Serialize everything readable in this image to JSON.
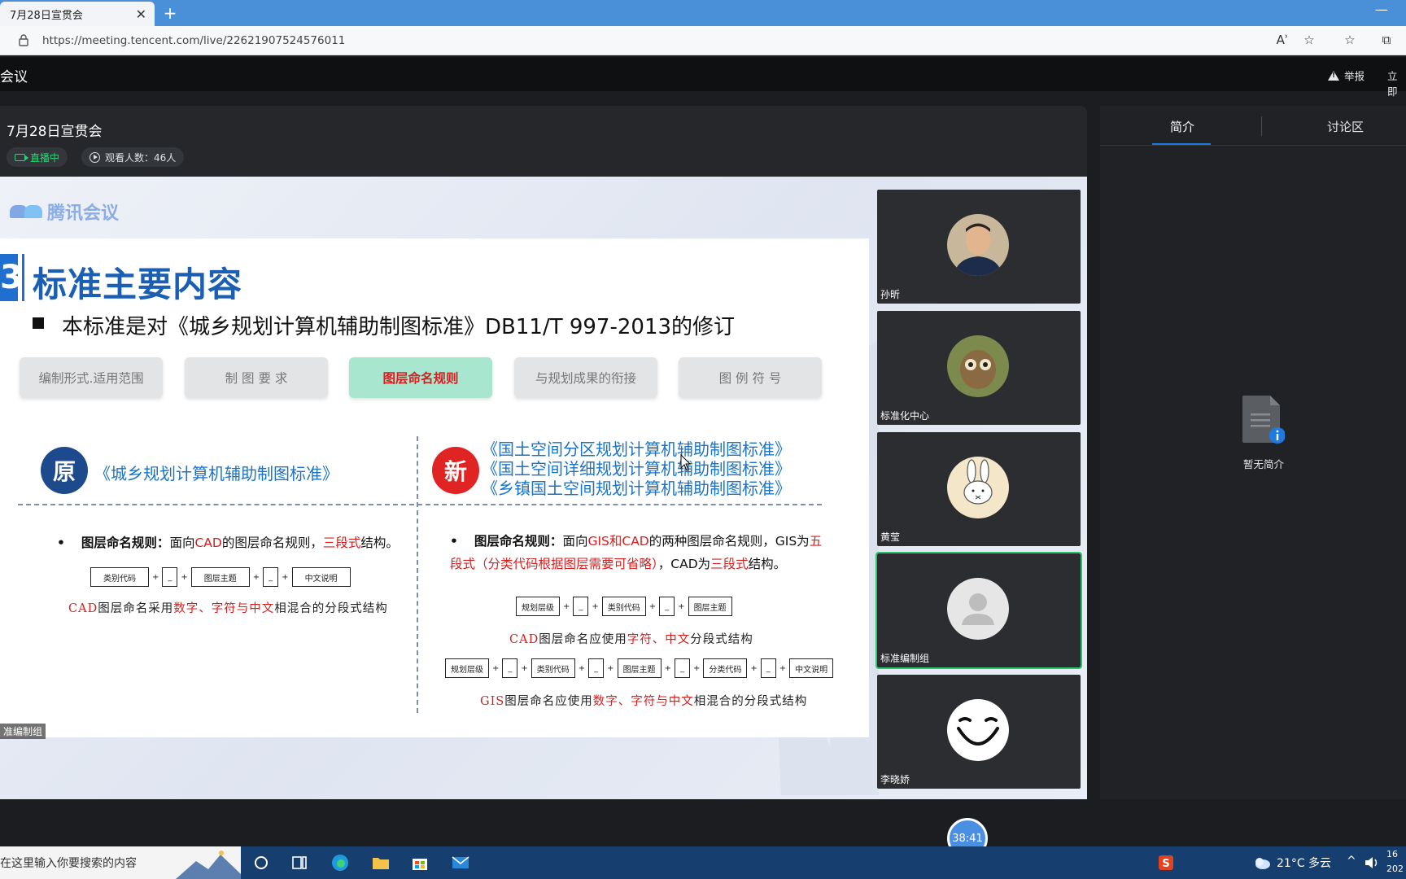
{
  "browser": {
    "tab_title": "7月28日宣贯会",
    "tab_close": "✕",
    "new_tab": "+",
    "minimize": "—",
    "url": "https://meeting.tencent.com/live/22621907524576011",
    "read_aloud": "Aʾ",
    "favorites_add": "☆",
    "favorites": "☆",
    "collections": "⧉"
  },
  "app": {
    "name": "会议",
    "report_label": "举报",
    "join_label": "立即"
  },
  "live": {
    "title": "7月28日宣贯会",
    "status": "直播中",
    "viewers": "观看人数：46人"
  },
  "slide": {
    "brand": "腾讯会议",
    "section_number": "3",
    "section_title": "标准主要内容",
    "subtitle": "本标准是对《城乡规划计算机辅助制图标准》DB11/T 997-2013的修订",
    "pills": [
      "编制形式.适用范围",
      "制 图 要 求",
      "图层命名规则",
      "与规划成果的衔接",
      "图 例 符 号"
    ],
    "old_mark": "原",
    "old_name": "《城乡规划计算机辅助制图标准》",
    "new_mark": "新",
    "new_names": [
      "《国土空间分区规划计算机辅助制图标准》",
      "《国土空间详细规划计算机辅助制图标准》",
      "《乡镇国土空间规划计算机辅助制图标准》"
    ],
    "left_rule": {
      "bullet": "•",
      "label": "图层命名规则：",
      "t1": "面向",
      "cad": "CAD",
      "t2": "的图层命名规则，",
      "three": "三段式",
      "t3": "结构。",
      "boxes": [
        "类别代码",
        "_",
        "图层主题",
        "_",
        "中文说明"
      ],
      "note_a": "CAD",
      "note_b": "图层命名采用",
      "note_c": "数字、字符与中文",
      "note_d": "相混合的分段式结构"
    },
    "right_rule": {
      "bullet": "•",
      "label": "图层命名规则：",
      "t1": "面向",
      "gis_cad": "GIS和CAD",
      "t2": "的两种图层命名规则，GIS为",
      "five": "五段式（分类代码根据图层需要可省略）",
      "t3": "，CAD为",
      "three": "三段式",
      "t4": "结构。",
      "cad_boxes": [
        "规划层级",
        "_",
        "类别代码",
        "_",
        "图层主题"
      ],
      "cad_note_a": "CAD",
      "cad_note_b": "图层命名应使用",
      "cad_note_c": "字符、中文",
      "cad_note_d": "分段式结构",
      "gis_boxes": [
        "规划层级",
        "_",
        "类别代码",
        "_",
        "图层主题",
        "_",
        "分类代码",
        "_",
        "中文说明"
      ],
      "gis_note_a": "GIS",
      "gis_note_b": "图层命名应使用",
      "gis_note_c": "数字、字符与中文",
      "gis_note_d": "相混合的分段式结构"
    },
    "box_sep": "+",
    "corner_label": "准编制组"
  },
  "participants": [
    "孙昕",
    "标准化中心",
    "黄莹",
    "标准编制组",
    "李晓娇"
  ],
  "side": {
    "tab_intro": "简介",
    "tab_discuss": "讨论区",
    "empty_intro": "暂无简介"
  },
  "timer": "38:41",
  "taskbar": {
    "search_placeholder": "在这里输入你要搜索的内容",
    "weather": "21°C  多云",
    "tray_arrow": "^",
    "clock_a": "16",
    "clock_b": "202"
  },
  "colors": {
    "accent": "#1f7ae0",
    "live_green": "#2fd27a",
    "slide_blue": "#1a5fb4",
    "highlight_red": "#d61f1f"
  }
}
